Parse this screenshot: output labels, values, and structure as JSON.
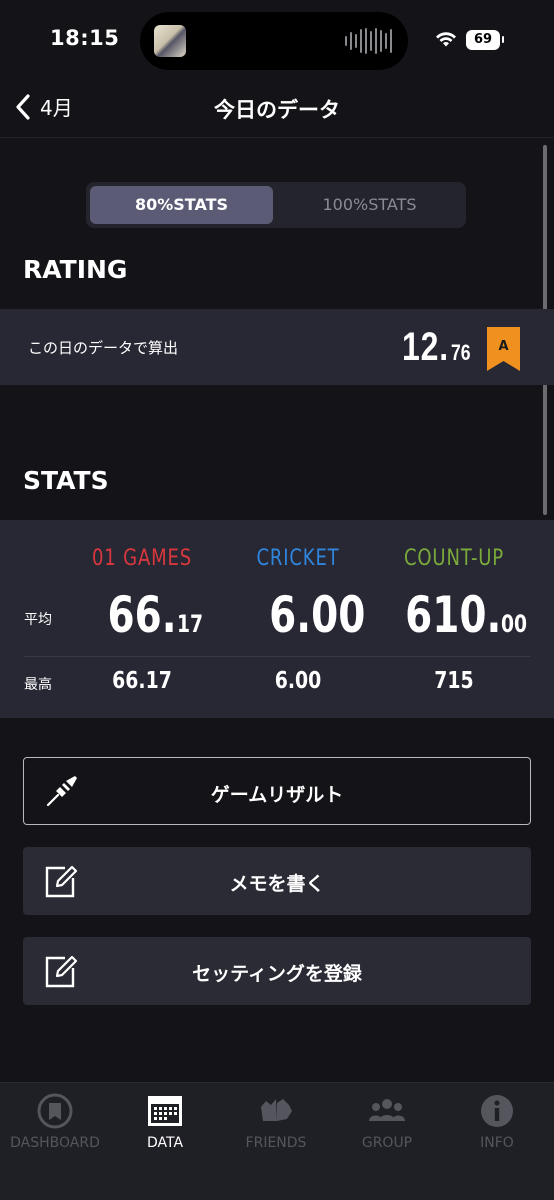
{
  "status_bar": {
    "time": "18:15",
    "battery": "69"
  },
  "nav": {
    "back_label": "4月",
    "title": "今日のデータ"
  },
  "segmented": {
    "options": [
      "80%STATS",
      "100%STATS"
    ],
    "selected": "80%STATS"
  },
  "rating": {
    "section_title": "RATING",
    "label": "この日のデータで算出",
    "value_int": "12.",
    "value_dec": "76",
    "badge": "A",
    "badge_color": "#f0901e"
  },
  "stats": {
    "section_title": "STATS",
    "columns": [
      {
        "name": "01 GAMES",
        "color": "#d9373e",
        "avg_int": "66.",
        "avg_dec": "17",
        "max": "66.17"
      },
      {
        "name": "CRICKET",
        "color": "#2f86de",
        "avg_int": "6.00",
        "avg_dec": "",
        "max": "6.00"
      },
      {
        "name": "COUNT-UP",
        "color": "#7aaa3a",
        "avg_int": "610.",
        "avg_dec": "00",
        "max": "715"
      }
    ],
    "row_labels": {
      "avg": "平均",
      "max": "最高"
    }
  },
  "actions": [
    {
      "label": "ゲームリザルト",
      "icon": "dart-icon"
    },
    {
      "label": "メモを書く",
      "icon": "edit-icon"
    },
    {
      "label": "セッティングを登録",
      "icon": "edit-icon"
    }
  ],
  "tabbar": {
    "items": [
      {
        "label": "DASHBOARD",
        "icon": "dashboard-icon",
        "active": false
      },
      {
        "label": "DATA",
        "icon": "calendar-icon",
        "active": true
      },
      {
        "label": "FRIENDS",
        "icon": "friends-icon",
        "active": false
      },
      {
        "label": "GROUP",
        "icon": "group-icon",
        "active": false
      },
      {
        "label": "INFO",
        "icon": "info-icon",
        "active": false
      }
    ]
  }
}
